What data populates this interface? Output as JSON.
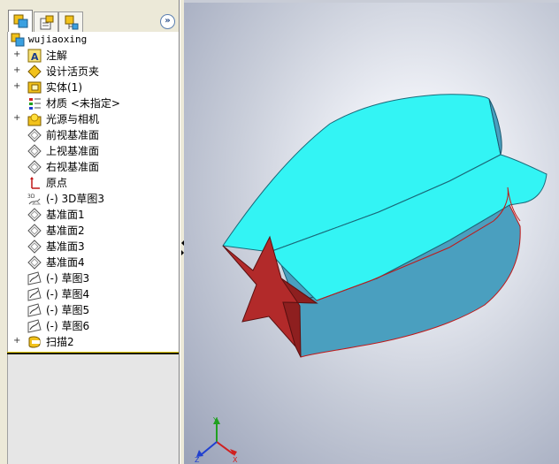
{
  "feature_manager": {
    "tabs": [
      {
        "name": "FeatureManager design tree",
        "icon": "feature-tree-icon",
        "active": true
      },
      {
        "name": "PropertyManager",
        "icon": "property-manager-icon",
        "active": false
      },
      {
        "name": "ConfigurationManager",
        "icon": "configuration-manager-icon",
        "active": false
      }
    ],
    "collapse_glyph": "»",
    "root": {
      "label": "wujiaoxing",
      "icon": "part-icon"
    },
    "items": [
      {
        "label": "注解",
        "icon": "annotations-icon",
        "expandable": true,
        "expander": "+"
      },
      {
        "label": "设计活页夹",
        "icon": "design-binder-icon",
        "expandable": true,
        "expander": "+"
      },
      {
        "label": "实体(1)",
        "icon": "solid-bodies-icon",
        "expandable": true,
        "expander": "+"
      },
      {
        "label": "材质 <未指定>",
        "icon": "material-icon",
        "expandable": false,
        "expander": ""
      },
      {
        "label": "光源与相机",
        "icon": "lights-cameras-icon",
        "expandable": true,
        "expander": "+"
      },
      {
        "label": "前视基准面",
        "icon": "plane-icon",
        "expandable": false,
        "expander": ""
      },
      {
        "label": "上视基准面",
        "icon": "plane-icon",
        "expandable": false,
        "expander": ""
      },
      {
        "label": "右视基准面",
        "icon": "plane-icon",
        "expandable": false,
        "expander": ""
      },
      {
        "label": "原点",
        "icon": "origin-icon",
        "expandable": false,
        "expander": ""
      },
      {
        "label": "(-) 3D草图3",
        "icon": "3d-sketch-icon",
        "expandable": false,
        "expander": ""
      },
      {
        "label": "基准面1",
        "icon": "plane-icon",
        "expandable": false,
        "expander": ""
      },
      {
        "label": "基准面2",
        "icon": "plane-icon",
        "expandable": false,
        "expander": ""
      },
      {
        "label": "基准面3",
        "icon": "plane-icon",
        "expandable": false,
        "expander": ""
      },
      {
        "label": "基准面4",
        "icon": "plane-icon",
        "expandable": false,
        "expander": ""
      },
      {
        "label": "(-) 草图3",
        "icon": "sketch-icon",
        "expandable": false,
        "expander": ""
      },
      {
        "label": "(-) 草图4",
        "icon": "sketch-icon",
        "expandable": false,
        "expander": ""
      },
      {
        "label": "(-) 草图5",
        "icon": "sketch-icon",
        "expandable": false,
        "expander": ""
      },
      {
        "label": "(-) 草图6",
        "icon": "sketch-icon",
        "expandable": false,
        "expander": ""
      },
      {
        "label": "扫描2",
        "icon": "sweep-icon",
        "expandable": true,
        "expander": "+"
      }
    ]
  },
  "viewport": {
    "background": "#c9ceda",
    "model": {
      "star_color": "#b22a2a",
      "cyan_face_color": "#33f4f4",
      "side_face_color": "#4a9fbf",
      "edge_color": "#c01818"
    },
    "triad": {
      "axes": [
        "X",
        "Y",
        "Z"
      ],
      "x_color": "#d02020",
      "y_color": "#20a020",
      "z_color": "#2040d0"
    }
  }
}
